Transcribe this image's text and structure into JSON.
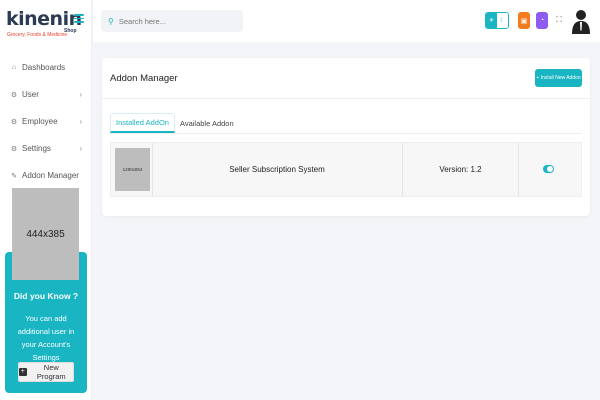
{
  "brand": {
    "logo_name": "kinenin",
    "tagline": "Grocery, Foods & Medicine",
    "shop_tag": "Shop",
    "accent_color": "#19b5c3",
    "logo_red": "#e8412c"
  },
  "search": {
    "placeholder": "Search here..."
  },
  "sidebar": {
    "items": [
      {
        "label": "Dashboards",
        "icon": "home-icon",
        "has_chevron": false
      },
      {
        "label": "User",
        "icon": "gear-icon",
        "has_chevron": true
      },
      {
        "label": "Employee",
        "icon": "gear-icon",
        "has_chevron": true
      },
      {
        "label": "Settings",
        "icon": "gear-icon",
        "has_chevron": true
      },
      {
        "label": "Addon Manager",
        "icon": "wrench-icon",
        "has_chevron": false
      }
    ],
    "placeholder_image_label": "444x385",
    "promo": {
      "title": "Did you Know ?",
      "text": "You can add additional user in your Account's Settings",
      "button_label": "New Program"
    }
  },
  "header": {
    "icons": [
      "theme-toggle-icon",
      "bag-icon",
      "bell-icon",
      "expand-icon",
      "user-avatar-icon"
    ],
    "orange": "#f47b20",
    "purple": "#8e5cf0"
  },
  "main": {
    "title": "Addon Manager",
    "install_button": "+ Install New Addon",
    "tabs": [
      {
        "label": "Installed AddOn",
        "active": true
      },
      {
        "label": "Available Addon",
        "active": false
      }
    ],
    "addons": [
      {
        "thumb_label": "1280x854",
        "name": "Seller Subscription System",
        "version": "Version: 1.2",
        "enabled": true
      }
    ]
  }
}
